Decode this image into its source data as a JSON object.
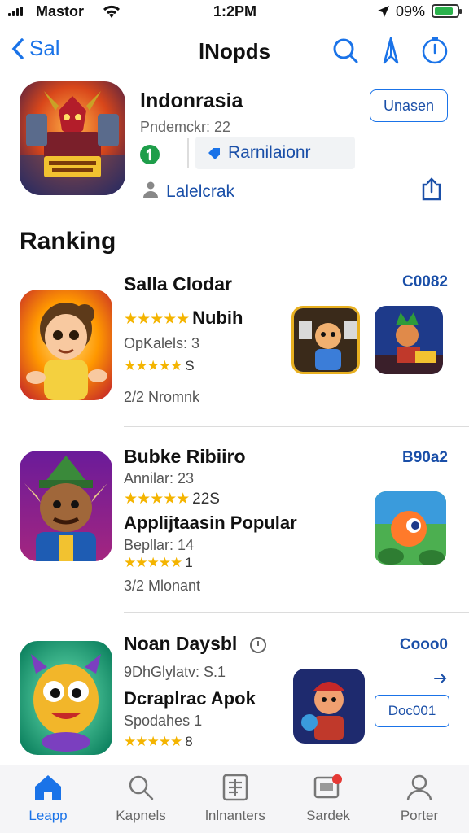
{
  "status_bar": {
    "carrier": "Mastor",
    "time": "1:2PM",
    "battery": "09%"
  },
  "nav": {
    "back_label": "Sal",
    "title": "lNopds"
  },
  "featured": {
    "name": "lndonrasia",
    "subtitle": "Pndemckr: 22",
    "category": "Rarnilaionr",
    "developer": "Lalelcrak",
    "open_label": "Unasen"
  },
  "section_title": "Ranking",
  "rows": [
    {
      "title": "Salla Clodar",
      "price": "C0082",
      "stars_text": "Nubih",
      "line2": "OpKalels: 3",
      "stars2_text": "S",
      "meta": "2/2  Nromnk"
    },
    {
      "title": "Bubke Ribiiro",
      "price": "B90a2",
      "line1": "Annilar: 23",
      "stars_text": "22S",
      "tagline": "Applijtaasin Popular",
      "line2": "Bepllar: 14",
      "stars2_text": "1",
      "meta": "3/2  Mlonant"
    },
    {
      "title": "Noan Daysbl",
      "price": "Cooo0",
      "line1": "9DhGlylatv: S.1",
      "tagline": "Dcraplrac Apok",
      "line2": "Spodahes 1",
      "stars_text": "8",
      "button_label": "Doc001"
    }
  ],
  "tabs": [
    {
      "label": "Leapp",
      "icon": "home-icon",
      "active": true
    },
    {
      "label": "Kapnels",
      "icon": "search-icon",
      "active": false
    },
    {
      "label": "lnlnanters",
      "icon": "list-icon",
      "active": false
    },
    {
      "label": "Sardek",
      "icon": "chat-icon",
      "active": false
    },
    {
      "label": "Porter",
      "icon": "profile-icon",
      "active": false
    }
  ],
  "colors": {
    "accent": "#1a73e8",
    "star": "#f4b400",
    "green": "#1e9e4a",
    "badge": "#e53935"
  }
}
